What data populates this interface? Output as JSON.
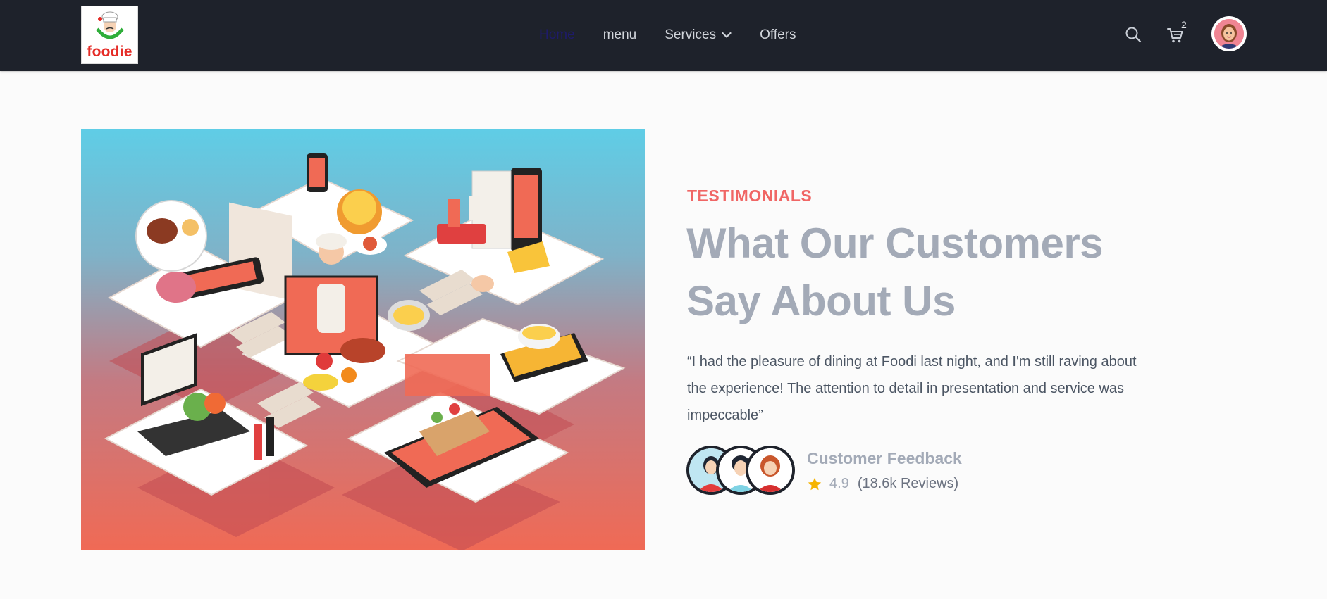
{
  "brand": {
    "name": "foodie"
  },
  "nav": {
    "links": [
      {
        "label": "Home",
        "active": true
      },
      {
        "label": "menu"
      },
      {
        "label": "Services",
        "has_dropdown": true
      },
      {
        "label": "Offers"
      }
    ],
    "search_icon": "search-icon",
    "cart_icon": "cart-icon",
    "cart_count": "2"
  },
  "testimonial": {
    "eyebrow": "TESTIMONIALS",
    "heading_line1": "What Our Customers",
    "heading_line2": "Say About Us",
    "quote": "“I had the pleasure of dining at Foodi last night, and I'm still raving about the experience! The attention to detail in presentation and service was impeccable”",
    "feedback_title": "Customer Feedback",
    "rating": "4.9",
    "reviews": "(18.6k Reviews)"
  },
  "colors": {
    "navbar": "#1e222b",
    "accent": "#f06665",
    "heading": "#a3aab7",
    "star": "#f5b400"
  }
}
